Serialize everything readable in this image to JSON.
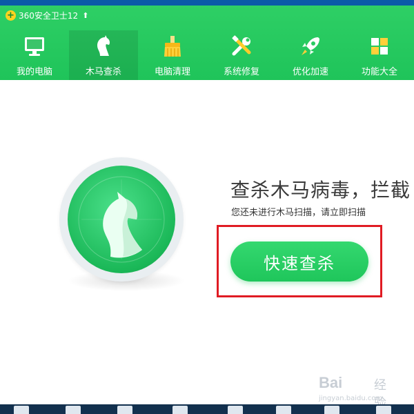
{
  "window": {
    "title": "360安全卫士12"
  },
  "nav": {
    "items": [
      {
        "label": "我的电脑",
        "icon": "monitor-icon",
        "active": false
      },
      {
        "label": "木马查杀",
        "icon": "horse-icon",
        "active": true
      },
      {
        "label": "电脑清理",
        "icon": "broom-icon",
        "active": false
      },
      {
        "label": "系统修复",
        "icon": "wrench-icon",
        "active": false
      },
      {
        "label": "优化加速",
        "icon": "rocket-icon",
        "active": false
      },
      {
        "label": "功能大全",
        "icon": "grid-icon",
        "active": false
      }
    ]
  },
  "main": {
    "headline": "查杀木马病毒，拦截",
    "subtitle": "您还未进行木马扫描，请立即扫描",
    "scan_button": "快速查杀"
  },
  "watermark": {
    "brand": "Bai",
    "brand2": "经验",
    "url": "jingyan.baidu.com"
  },
  "colors": {
    "brand_green": "#1fc45a",
    "highlight_red": "#e01b23"
  }
}
